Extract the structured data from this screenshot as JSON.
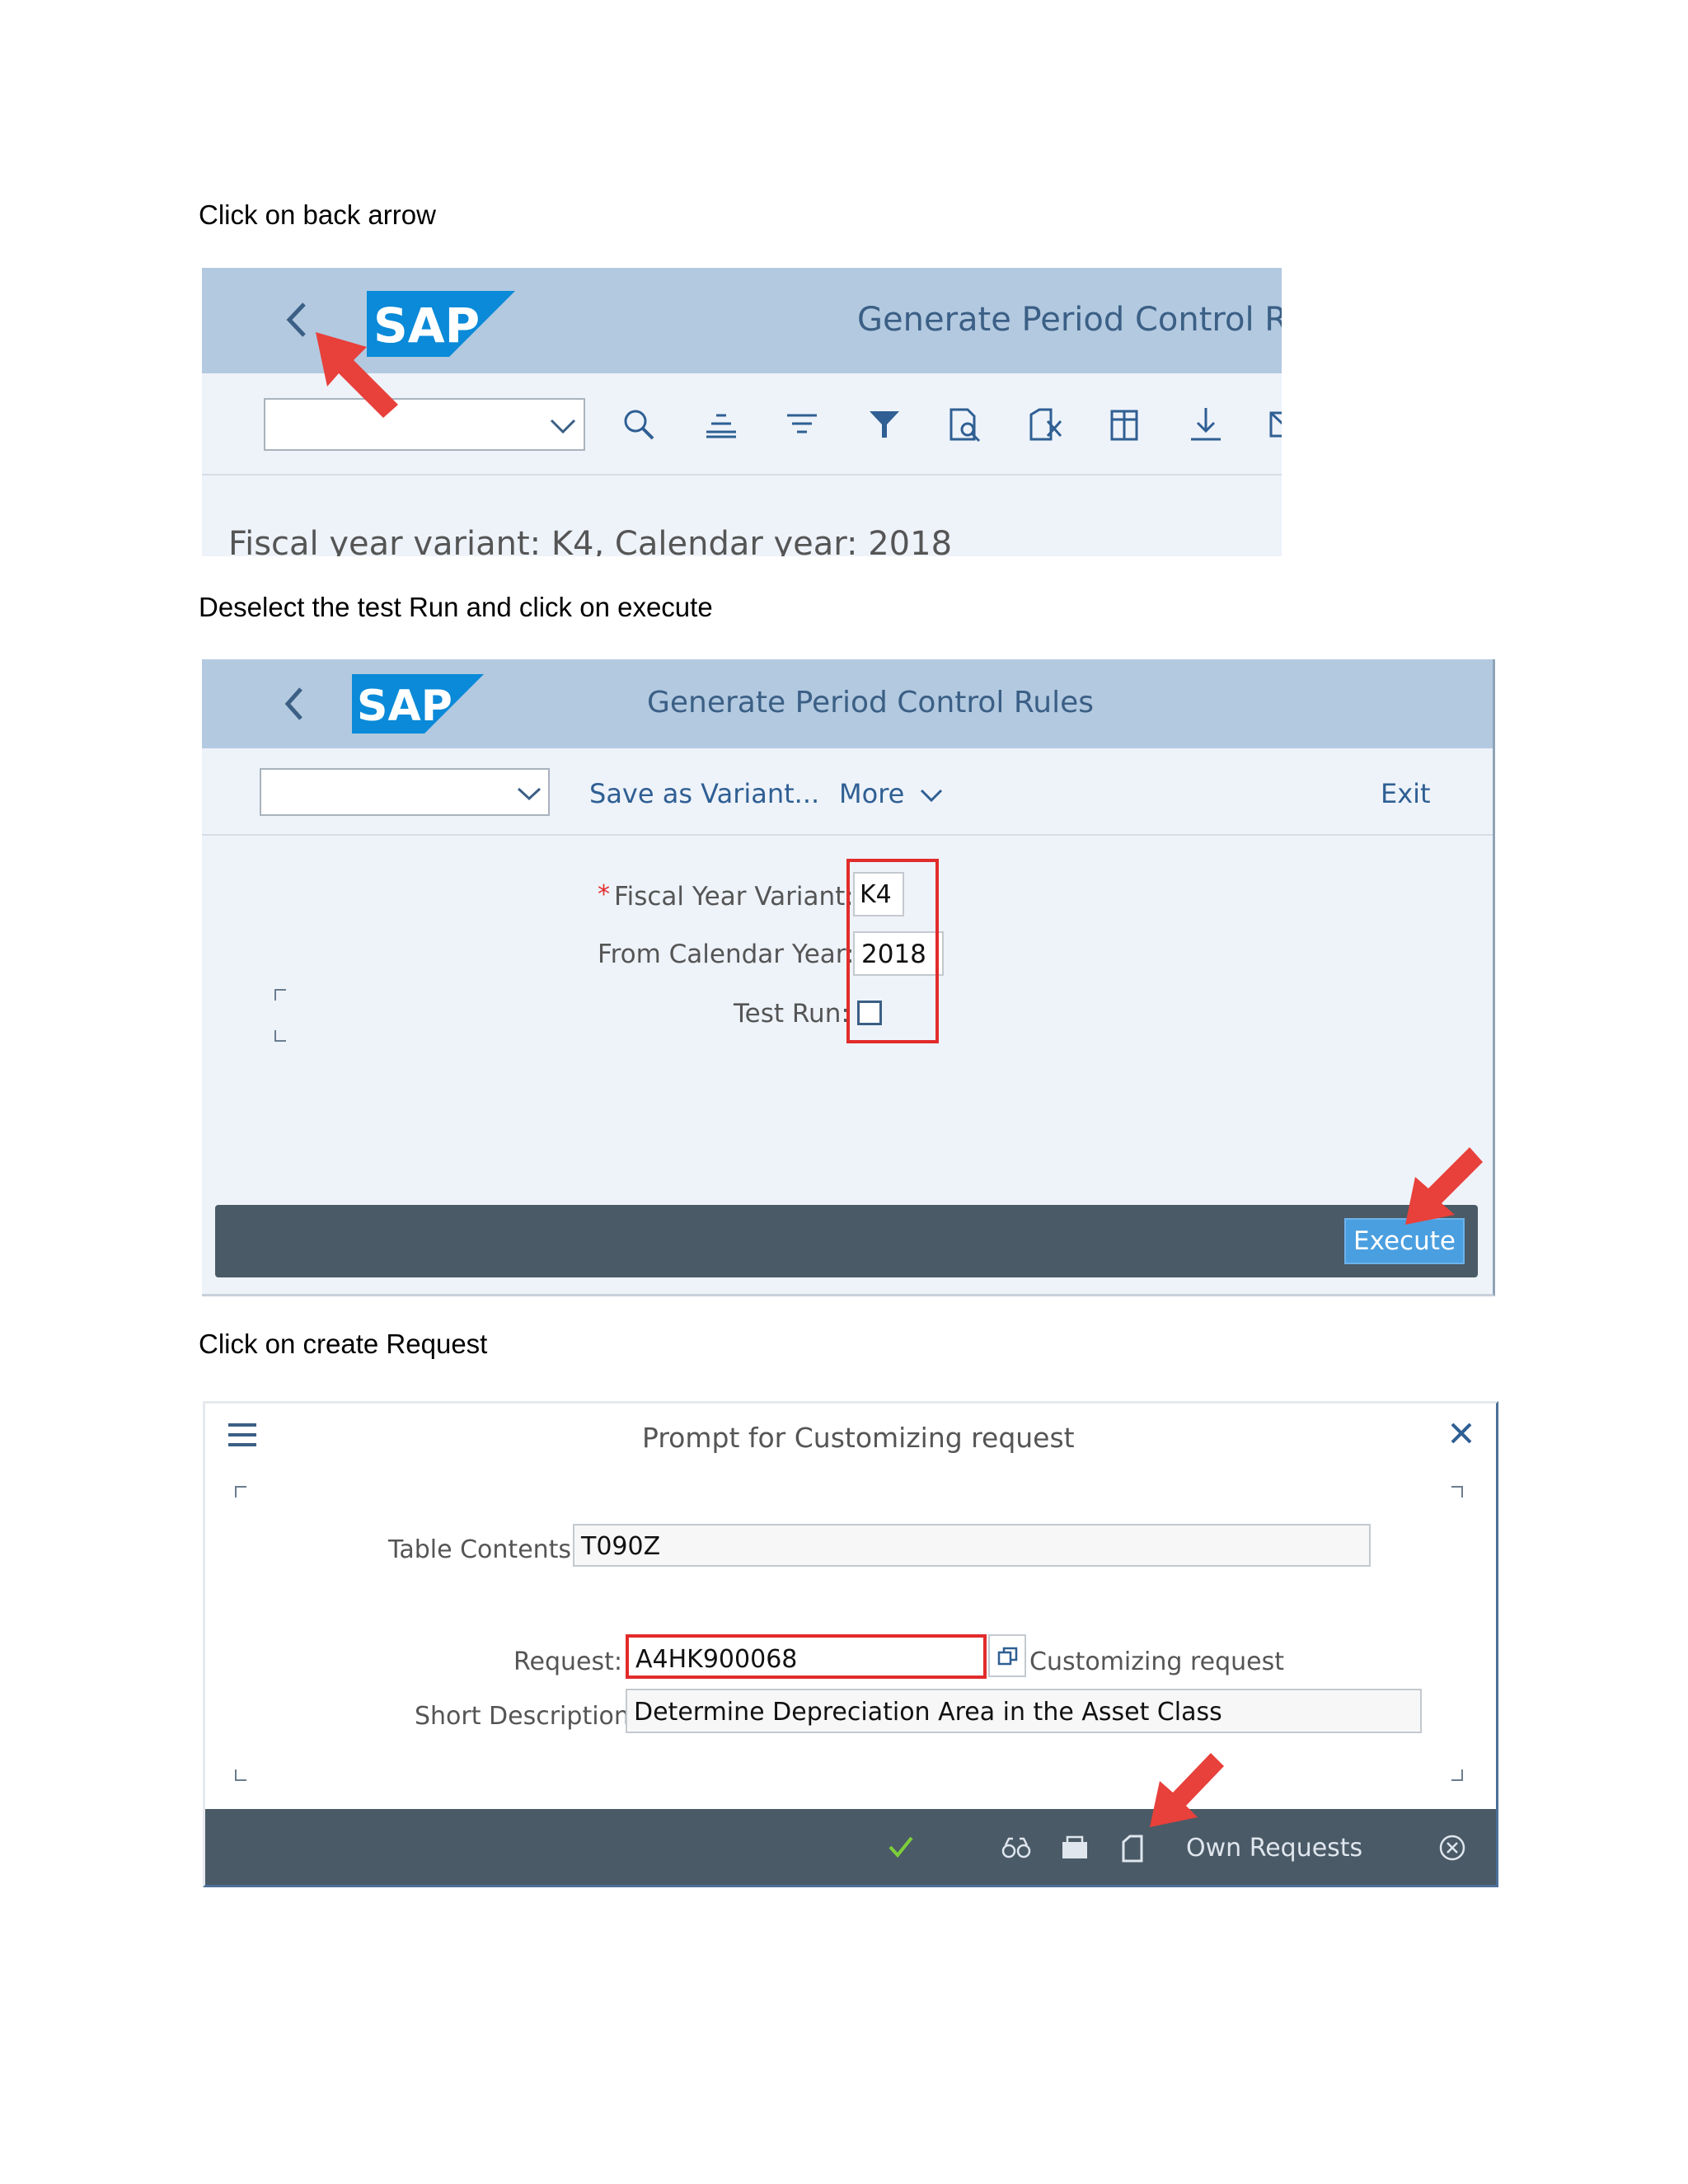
{
  "steps": {
    "step1": "Click on back arrow",
    "step2": "Deselect the test Run and click on execute",
    "step3": "Click on create Request"
  },
  "screen1": {
    "logo_text": "SAP",
    "title": "Generate Period Control Rule",
    "toolbar_icons": [
      "search-icon",
      "sort-ascending-icon",
      "sort-descending-icon",
      "filter-icon",
      "print-preview-icon",
      "export-excel-icon",
      "layout-icon",
      "download-icon",
      "mail-icon"
    ],
    "content_text": "Fiscal year variant: K4, Calendar year: 2018"
  },
  "screen2": {
    "logo_text": "SAP",
    "title": "Generate Period Control Rules",
    "save_variant": "Save as Variant...",
    "more": "More",
    "exit": "Exit",
    "required_marker": "*",
    "fiscal_year_variant_label": "Fiscal Year Variant:",
    "fiscal_year_variant_value": "K4",
    "from_calendar_year_label": "From Calendar Year:",
    "from_calendar_year_value": "2018",
    "test_run_label": "Test Run:",
    "test_run_checked": false,
    "execute": "Execute"
  },
  "screen3": {
    "title": "Prompt for Customizing request",
    "table_contents_label": "Table Contents:",
    "table_contents_value": "T090Z",
    "request_label": "Request:",
    "request_value": "A4HK900068",
    "request_type": "Customizing request",
    "short_description_label": "Short Description:",
    "short_description_value": "Determine Depreciation Area in the Asset Class",
    "own_requests": "Own Requests",
    "footer_icons": [
      "checkmark-icon",
      "glasses-icon",
      "create-request-icon",
      "new-document-icon",
      "cancel-icon"
    ]
  },
  "colors": {
    "shell": "#b2c9e0",
    "background": "#eef3fa",
    "footer": "#4a5a66",
    "execute_button": "#4a9fe0",
    "highlight_red": "#e22b2b",
    "sap_blue": "#0a8ad8"
  }
}
